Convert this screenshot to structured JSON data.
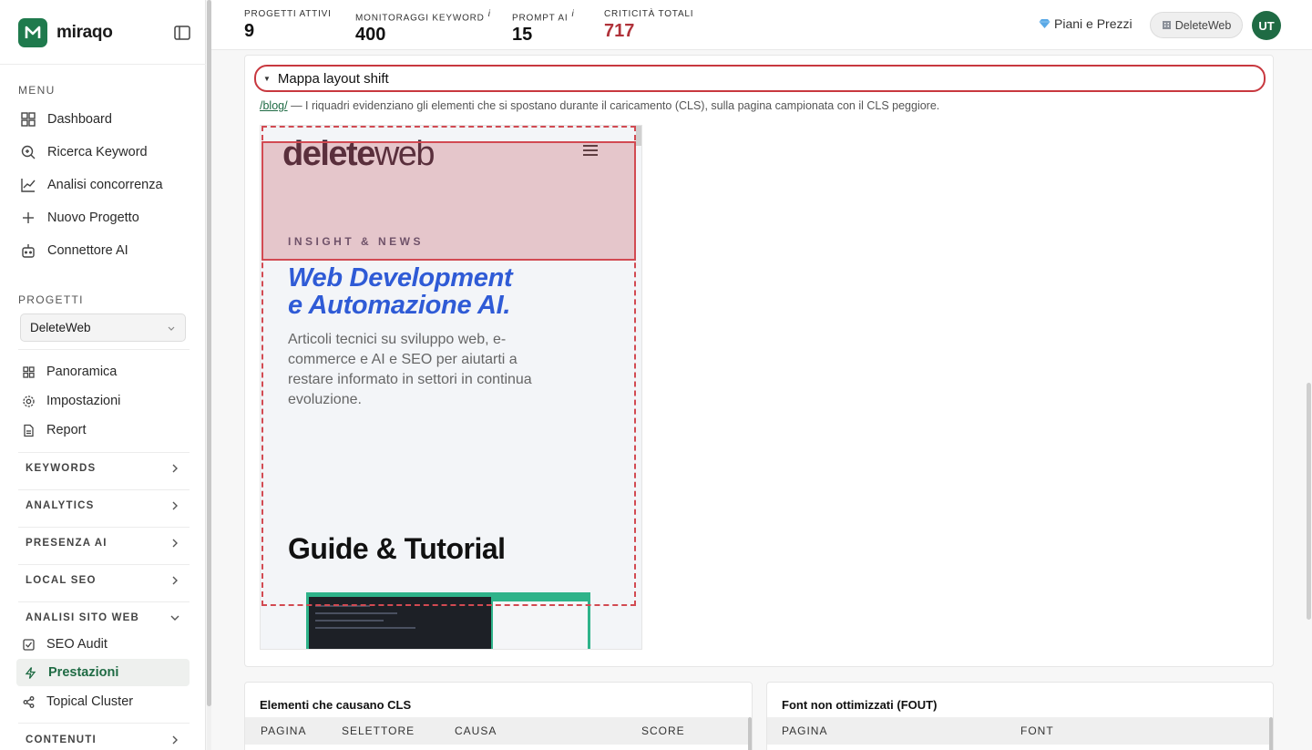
{
  "brand": {
    "name": "miraqo"
  },
  "menu": {
    "label": "MENU",
    "items": [
      {
        "label": "Dashboard",
        "icon": "grid-icon"
      },
      {
        "label": "Ricerca Keyword",
        "icon": "search-icon"
      },
      {
        "label": "Analisi concorrenza",
        "icon": "chart-line-icon"
      },
      {
        "label": "Nuovo Progetto",
        "icon": "plus-icon"
      },
      {
        "label": "Connettore AI",
        "icon": "bot-icon"
      }
    ]
  },
  "projects": {
    "label": "PROGETTI",
    "selected": "DeleteWeb",
    "items": [
      {
        "label": "Panoramica",
        "icon": "grid-small-icon"
      },
      {
        "label": "Impostazioni",
        "icon": "gear-icon"
      },
      {
        "label": "Report",
        "icon": "file-icon"
      }
    ]
  },
  "groups": [
    {
      "label": "KEYWORDS"
    },
    {
      "label": "ANALYTICS"
    },
    {
      "label": "PRESENZA AI"
    },
    {
      "label": "LOCAL SEO"
    },
    {
      "label": "ANALISI SITO WEB"
    }
  ],
  "site_analysis": {
    "items": [
      {
        "label": "SEO Audit",
        "icon": "check-square-icon"
      },
      {
        "label": "Prestazioni",
        "icon": "bolt-icon"
      },
      {
        "label": "Topical Cluster",
        "icon": "share-icon"
      }
    ]
  },
  "contents_group": {
    "label": "CONTENUTI"
  },
  "stats": [
    {
      "label": "PROGETTI ATTIVI",
      "value": "9",
      "info": ""
    },
    {
      "label": "MONITORAGGI KEYWORD",
      "value": "400",
      "info": "i"
    },
    {
      "label": "PROMPT AI",
      "value": "15",
      "info": "i"
    },
    {
      "label": "CRITICITÀ TOTALI",
      "value": "717",
      "info": ""
    }
  ],
  "header": {
    "plans_label": "Piani e Prezzi",
    "workspace_label": "DeleteWeb",
    "avatar_initials": "UT"
  },
  "layout_shift": {
    "summary": "Mappa layout shift",
    "link": "/blog/",
    "description": " — I riquadri evidenziano gli elementi che si spostano durante il caricamento (CLS), sulla pagina campionata con il CLS peggiore."
  },
  "preview": {
    "logo_bold": "delete",
    "logo_light": "web",
    "eyebrow": "INSIGHT & NEWS",
    "headline_1": "Web Development",
    "headline_2": "e Automazione AI.",
    "paragraph": "Articoli tecnici su sviluppo web, e-commerce e AI e SEO per aiutarti a restare informato in settori in continua evoluzione.",
    "section_title": "Guide & Tutorial"
  },
  "cls_table": {
    "title": "Elementi che causano CLS",
    "columns": [
      "PAGINA",
      "SELETTORE",
      "CAUSA",
      "SCORE"
    ]
  },
  "font_table": {
    "title": "Font non ottimizzati (FOUT)",
    "columns": [
      "PAGINA",
      "FONT"
    ]
  },
  "colors": {
    "brand": "#1f7a4d",
    "alert": "#b0323a",
    "highlight": "#d24a52"
  }
}
